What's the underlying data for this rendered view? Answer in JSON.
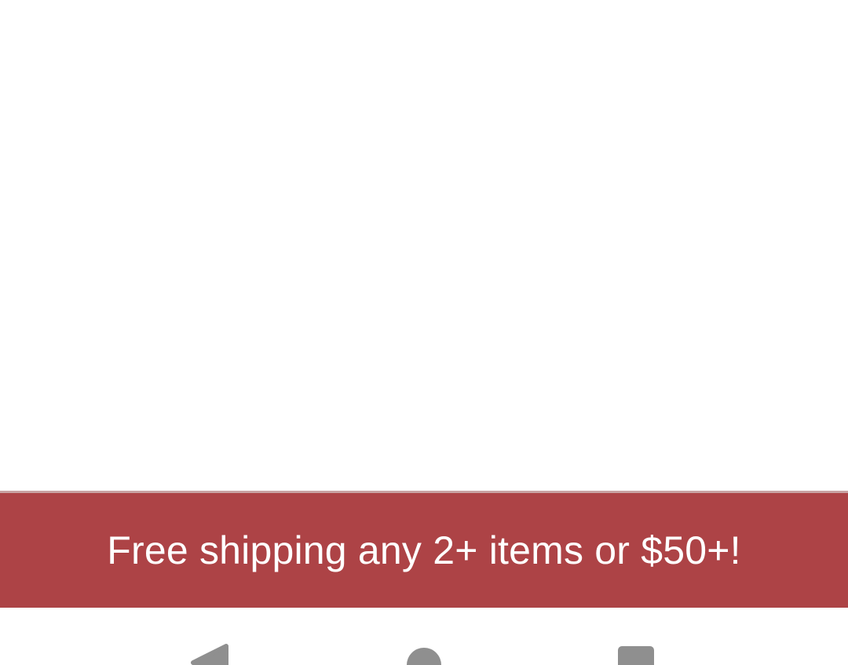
{
  "promo_banner": {
    "text": "Free shipping any 2+ items or $50+!",
    "background_color": "#ad4346",
    "text_color": "#ffffff"
  },
  "nav_bar": {
    "icon_color": "#8f8f8f",
    "buttons": [
      {
        "icon": "back-icon"
      },
      {
        "icon": "home-icon"
      },
      {
        "icon": "recents-icon"
      }
    ]
  }
}
